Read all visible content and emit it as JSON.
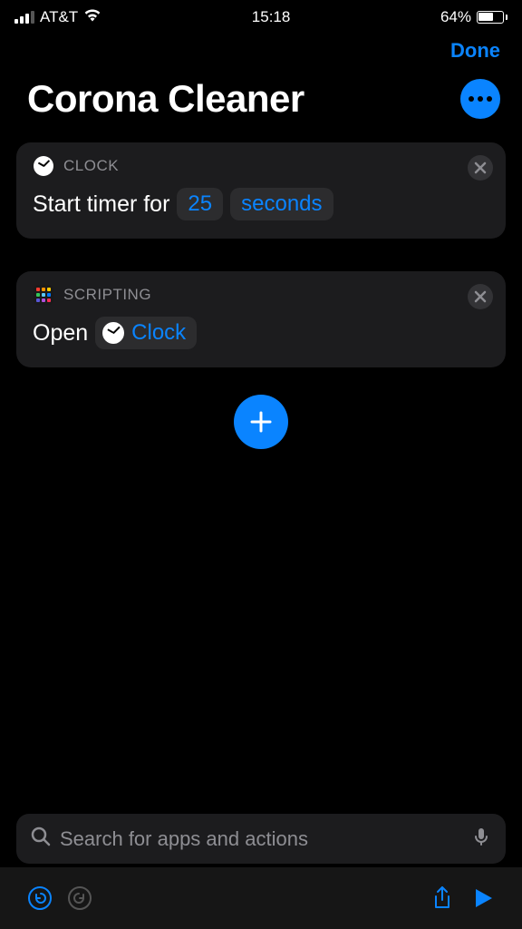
{
  "status": {
    "carrier": "AT&T",
    "time": "15:18",
    "battery_pct": "64%"
  },
  "nav": {
    "done": "Done"
  },
  "header": {
    "title": "Corona Cleaner"
  },
  "actions": [
    {
      "category": "CLOCK",
      "text_prefix": "Start timer for",
      "param_value": "25",
      "param_unit": "seconds"
    },
    {
      "category": "SCRIPTING",
      "text_prefix": "Open",
      "app_name": "Clock"
    }
  ],
  "search": {
    "placeholder": "Search for apps and actions"
  }
}
